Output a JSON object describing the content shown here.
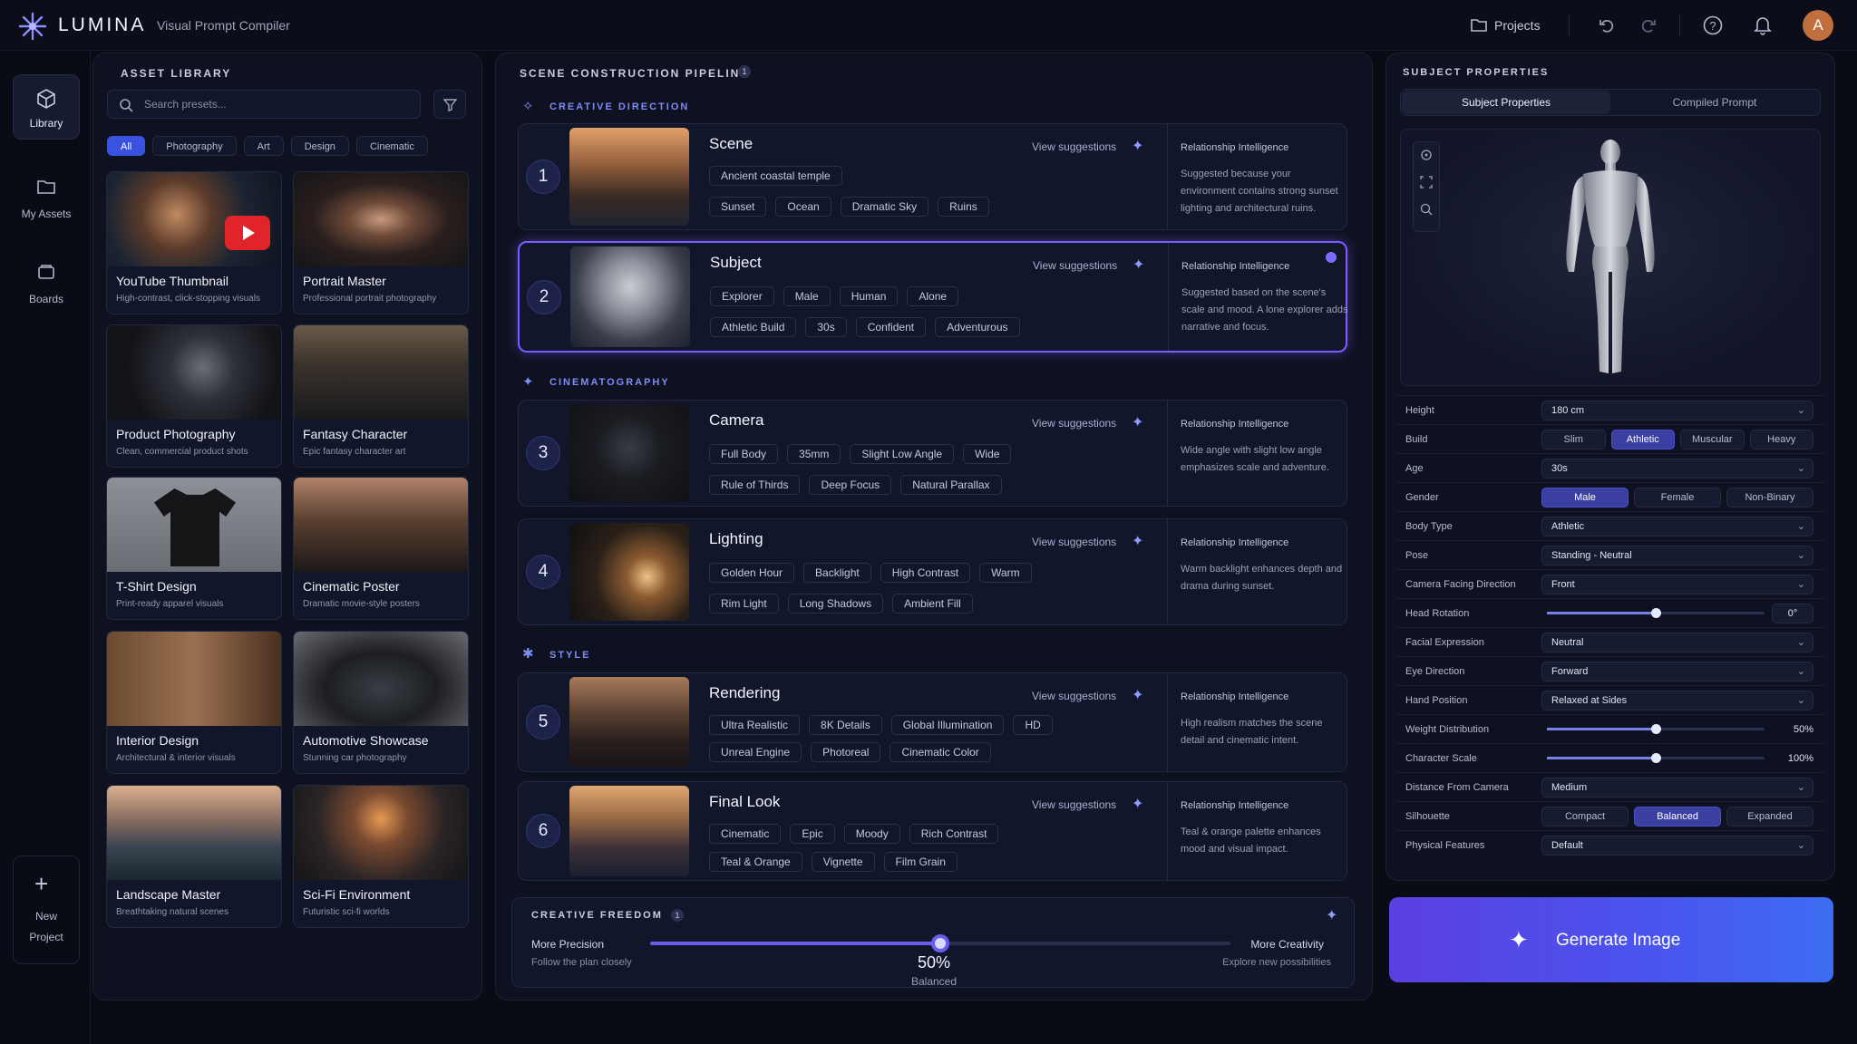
{
  "app": {
    "name": "LUMINA",
    "subtitle": "Visual Prompt Compiler"
  },
  "topbar": {
    "projects_label": "Projects",
    "avatar_initial": "A"
  },
  "leftnav": {
    "items": [
      {
        "label": "Library",
        "icon": "cube-icon"
      },
      {
        "label": "My Assets",
        "icon": "folder-icon"
      },
      {
        "label": "Boards",
        "icon": "boards-icon"
      }
    ],
    "new_project_line1": "New",
    "new_project_line2": "Project"
  },
  "asset_library": {
    "title": "ASSET LIBRARY",
    "search_placeholder": "Search presets...",
    "filters": [
      "All",
      "Photography",
      "Art",
      "Design",
      "Cinematic"
    ],
    "cards": [
      {
        "name": "YouTube Thumbnail",
        "desc": "High-contrast, click-stopping visuals"
      },
      {
        "name": "Portrait Master",
        "desc": "Professional portrait photography"
      },
      {
        "name": "Product Photography",
        "desc": "Clean, commercial product shots"
      },
      {
        "name": "Fantasy Character",
        "desc": "Epic fantasy character art"
      },
      {
        "name": "T-Shirt Design",
        "desc": "Print-ready apparel visuals"
      },
      {
        "name": "Cinematic Poster",
        "desc": "Dramatic movie-style posters"
      },
      {
        "name": "Interior Design",
        "desc": "Architectural & interior visuals"
      },
      {
        "name": "Automotive Showcase",
        "desc": "Stunning car photography"
      },
      {
        "name": "Landscape Master",
        "desc": "Breathtaking natural scenes"
      },
      {
        "name": "Sci-Fi Environment",
        "desc": "Futuristic sci-fi worlds"
      }
    ]
  },
  "pipeline": {
    "title": "SCENE CONSTRUCTION PIPELINE",
    "info_badge": "1",
    "groups": [
      "CREATIVE DIRECTION",
      "CINEMATOGRAPHY",
      "STYLE"
    ],
    "view_suggestions": "View suggestions",
    "rel_title": "Relationship Intelligence",
    "steps": [
      {
        "num": "1",
        "title": "Scene",
        "row1": [
          "Ancient coastal temple"
        ],
        "row2": [
          "Sunset",
          "Ocean",
          "Dramatic Sky",
          "Ruins"
        ],
        "rel": "Suggested because your environment contains strong sunset lighting and architectural ruins."
      },
      {
        "num": "2",
        "title": "Subject",
        "row1": [
          "Explorer",
          "Male",
          "Human",
          "Alone"
        ],
        "row2": [
          "Athletic Build",
          "30s",
          "Confident",
          "Adventurous"
        ],
        "rel": "Suggested based on the scene's scale and mood. A lone explorer adds narrative and focus."
      },
      {
        "num": "3",
        "title": "Camera",
        "row1": [
          "Full Body",
          "35mm",
          "Slight Low Angle",
          "Wide"
        ],
        "row2": [
          "Rule of Thirds",
          "Deep Focus",
          "Natural Parallax"
        ],
        "rel": "Wide angle with slight low angle emphasizes scale and adventure."
      },
      {
        "num": "4",
        "title": "Lighting",
        "row1": [
          "Golden Hour",
          "Backlight",
          "High Contrast",
          "Warm"
        ],
        "row2": [
          "Rim Light",
          "Long Shadows",
          "Ambient Fill"
        ],
        "rel": "Warm backlight enhances depth and drama during sunset."
      },
      {
        "num": "5",
        "title": "Rendering",
        "row1": [
          "Ultra Realistic",
          "8K Details",
          "Global Illumination",
          "HD"
        ],
        "row2": [
          "Unreal Engine",
          "Photoreal",
          "Cinematic Color"
        ],
        "rel": "High realism matches the scene detail and cinematic intent."
      },
      {
        "num": "6",
        "title": "Final Look",
        "row1": [
          "Cinematic",
          "Epic",
          "Moody",
          "Rich Contrast"
        ],
        "row2": [
          "Teal & Orange",
          "Vignette",
          "Film Grain"
        ],
        "rel": "Teal & orange palette enhances mood and visual impact."
      }
    ]
  },
  "creative_freedom": {
    "title": "CREATIVE FREEDOM",
    "info_badge": "1",
    "left_title": "More Precision",
    "left_sub": "Follow the plan closely",
    "right_title": "More Creativity",
    "right_sub": "Explore new possibilities",
    "value": 0.5,
    "value_label": "50%",
    "value_sub": "Balanced"
  },
  "subject_props": {
    "title": "SUBJECT PROPERTIES",
    "tabs": [
      "Subject Properties",
      "Compiled Prompt"
    ],
    "height_label": "Height",
    "height_value": "180 cm",
    "build_label": "Build",
    "build_options": [
      "Slim",
      "Athletic",
      "Muscular",
      "Heavy"
    ],
    "build_selected": "Athletic",
    "age_label": "Age",
    "age_value": "30s",
    "gender_label": "Gender",
    "gender_options": [
      "Male",
      "Female",
      "Non-Binary"
    ],
    "gender_selected": "Male",
    "body_type_label": "Body Type",
    "body_type_value": "Athletic",
    "pose_label": "Pose",
    "pose_value": "Standing - Neutral",
    "facing_label": "Camera Facing Direction",
    "facing_value": "Front",
    "head_rot_label": "Head Rotation",
    "head_rot_value": "0°",
    "head_rot_level": 0.5,
    "facial_label": "Facial Expression",
    "facial_value": "Neutral",
    "eye_label": "Eye Direction",
    "eye_value": "Forward",
    "hand_label": "Hand Position",
    "hand_value": "Relaxed at Sides",
    "weight_label": "Weight Distribution",
    "weight_value": "50%",
    "weight_level": 0.5,
    "scale_label": "Character Scale",
    "scale_value": "100%",
    "scale_level": 0.5,
    "distance_label": "Distance From Camera",
    "distance_value": "Medium",
    "silhouette_label": "Silhouette",
    "silhouette_options": [
      "Compact",
      "Balanced",
      "Expanded"
    ],
    "silhouette_selected": "Balanced",
    "features_label": "Physical Features",
    "features_value": "Default"
  },
  "generate": {
    "label": "Generate Image"
  },
  "colors": {
    "accent": "#6a4cf0",
    "selected_border": "#7b5cff",
    "blue": "#3a52e0"
  }
}
